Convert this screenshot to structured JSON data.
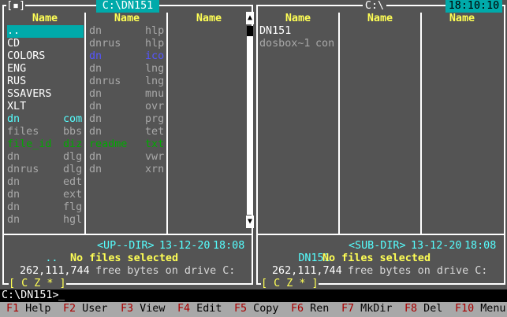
{
  "clock": "18:10:10",
  "left_panel": {
    "path": "C:\\DN151",
    "col_header": "Name",
    "columns": [
      [
        {
          "name": "..",
          "ext": "",
          "style": "dir",
          "selected": true
        },
        {
          "name": "CD",
          "ext": "",
          "style": "dir"
        },
        {
          "name": "COLORS",
          "ext": "",
          "style": "dir"
        },
        {
          "name": "ENG",
          "ext": "",
          "style": "dir"
        },
        {
          "name": "RUS",
          "ext": "",
          "style": "dir"
        },
        {
          "name": "SSAVERS",
          "ext": "",
          "style": "dir"
        },
        {
          "name": "XLT",
          "ext": "",
          "style": "dir"
        },
        {
          "name": "dn",
          "ext": "com",
          "style": "cyan"
        },
        {
          "name": "files",
          "ext": "bbs",
          "style": "grey"
        },
        {
          "name": "file_id",
          "ext": "diz",
          "style": "green"
        },
        {
          "name": "dn",
          "ext": "dlg",
          "style": "grey"
        },
        {
          "name": "dnrus",
          "ext": "dlg",
          "style": "grey"
        },
        {
          "name": "dn",
          "ext": "edt",
          "style": "grey"
        },
        {
          "name": "dn",
          "ext": "ext",
          "style": "grey"
        },
        {
          "name": "dn",
          "ext": "flg",
          "style": "grey"
        },
        {
          "name": "dn",
          "ext": "hgl",
          "style": "grey"
        }
      ],
      [
        {
          "name": "dn",
          "ext": "hlp",
          "style": "grey"
        },
        {
          "name": "dnrus",
          "ext": "hlp",
          "style": "grey"
        },
        {
          "name": "dn",
          "ext": "ico",
          "style": "blue"
        },
        {
          "name": "dn",
          "ext": "lng",
          "style": "grey"
        },
        {
          "name": "dnrus",
          "ext": "lng",
          "style": "grey"
        },
        {
          "name": "dn",
          "ext": "mnu",
          "style": "grey"
        },
        {
          "name": "dn",
          "ext": "ovr",
          "style": "grey"
        },
        {
          "name": "dn",
          "ext": "prg",
          "style": "grey"
        },
        {
          "name": "dn",
          "ext": "tet",
          "style": "grey"
        },
        {
          "name": "readme",
          "ext": "txt",
          "style": "green"
        },
        {
          "name": "dn",
          "ext": "vwr",
          "style": "grey"
        },
        {
          "name": "dn",
          "ext": "xrn",
          "style": "grey"
        }
      ],
      []
    ],
    "info_name": "..",
    "info_type": "<UP--DIR>",
    "info_date": "13-12-20",
    "info_time": "18:08",
    "status": "No files selected",
    "free_bytes": "262,111,744",
    "free_text": "free bytes on drive C:",
    "drives": "[ C Z * ]"
  },
  "right_panel": {
    "path": "C:\\",
    "col_header": "Name",
    "columns": [
      [
        {
          "name": "DN151",
          "ext": "",
          "style": "dir"
        },
        {
          "name": "dosbox~1",
          "ext": "con",
          "style": "grey"
        }
      ],
      [],
      []
    ],
    "info_name": "DN151",
    "info_type": "<SUB-DIR>",
    "info_date": "13-12-20",
    "info_time": "18:08",
    "status": "No files selected",
    "free_bytes": "262,111,744",
    "free_text": "free bytes on drive C:",
    "drives": "[ C Z * ]"
  },
  "command_prompt": "C:\\DN151>",
  "keybar": [
    {
      "num": "F1",
      "label": "Help"
    },
    {
      "num": "F2",
      "label": "User"
    },
    {
      "num": "F3",
      "label": "View"
    },
    {
      "num": "F4",
      "label": "Edit"
    },
    {
      "num": "F5",
      "label": "Copy"
    },
    {
      "num": "F6",
      "label": "Ren"
    },
    {
      "num": "F7",
      "label": "MkDir"
    },
    {
      "num": "F8",
      "label": "Del"
    },
    {
      "num": "F10",
      "label": "Menu"
    }
  ],
  "window_button": "[▪]",
  "scroll_up": "▲",
  "scroll_down": "▼"
}
